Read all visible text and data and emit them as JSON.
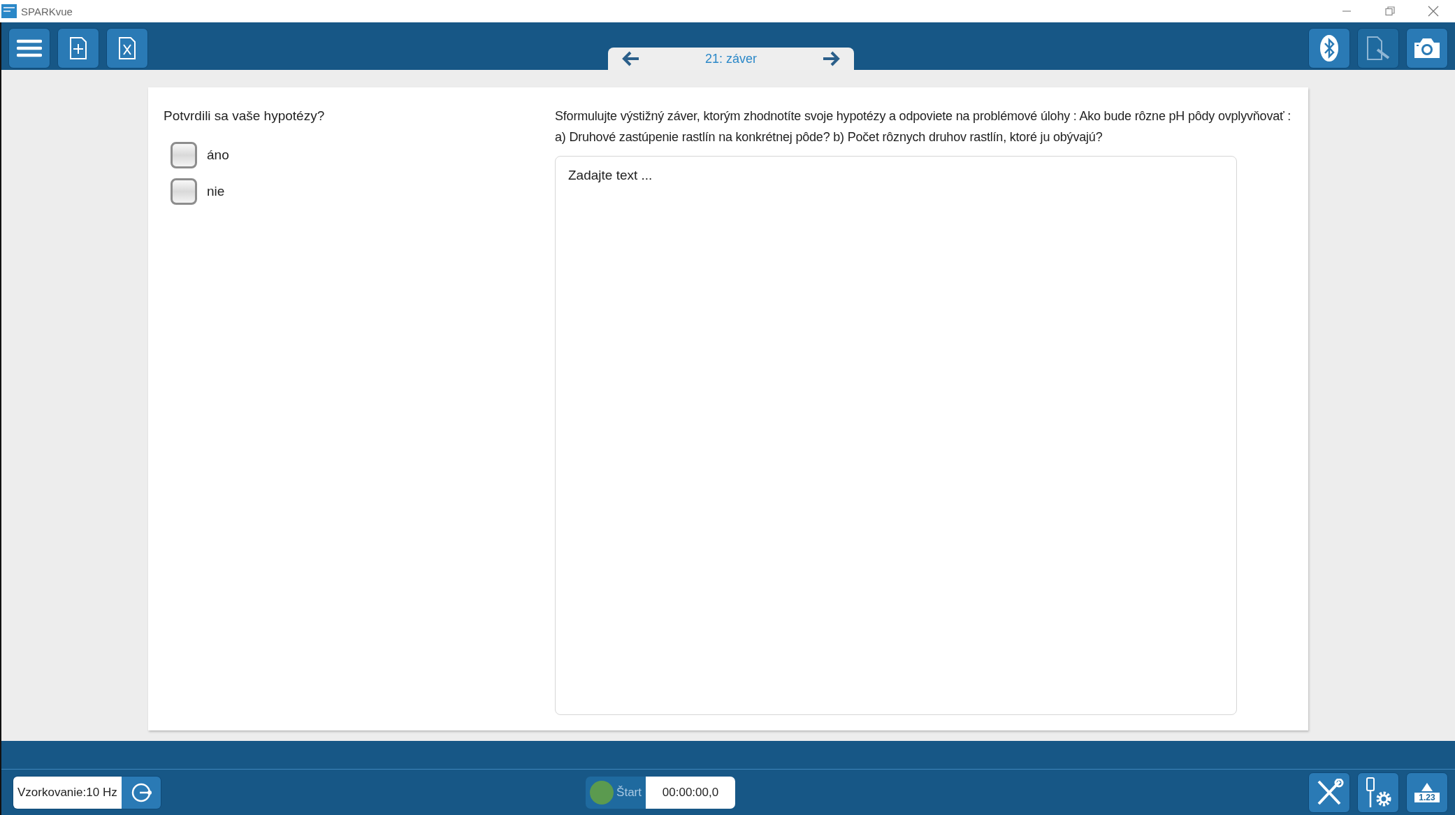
{
  "window": {
    "title": "SPARKvue"
  },
  "page_nav": {
    "label": "21: záver"
  },
  "question_left": {
    "prompt": "Potvrdili sa vaše hypotézy?",
    "options": [
      {
        "label": "áno",
        "checked": false
      },
      {
        "label": "nie",
        "checked": false
      }
    ]
  },
  "question_right": {
    "prompt": "Sformulujte výstižný záver, ktorým zhodnotíte svoje hypotézy a odpoviete na problémové úlohy :  Ako bude rôzne pH pôdy ovplyvňovať :  a) Druhové zastúpenie rastlín na konkrétnej pôde? b) Počet rôznych druhov rastlín, ktoré ju obývajú?",
    "answer": {
      "placeholder": "Zadajte text ..."
    }
  },
  "status_bar": {
    "sampling": "Vzorkovanie:10 Hz",
    "start_label": "Štart",
    "timer": "00:00:00,0",
    "meter_label": "1.23"
  }
}
